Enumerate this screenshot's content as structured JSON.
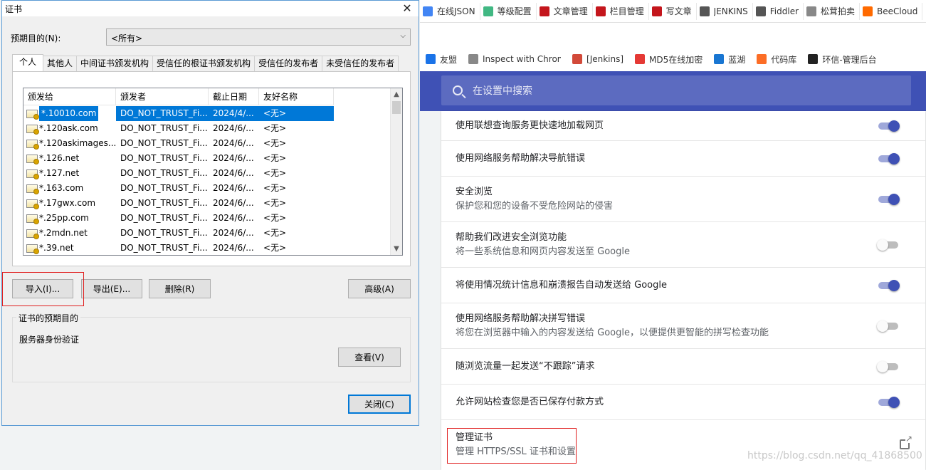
{
  "browser": {
    "bookmarks_row1": [
      {
        "icon": "tab-icon",
        "label": "在线JSON",
        "color": "#4285f4"
      },
      {
        "icon": "vue-icon",
        "label": "等级配置",
        "color": "#41b883"
      },
      {
        "icon": "csdn-icon",
        "label": "文章管理",
        "color": "#c4161c"
      },
      {
        "icon": "csdn-icon",
        "label": "栏目管理",
        "color": "#c4161c"
      },
      {
        "icon": "csdn-icon",
        "label": "写文章",
        "color": "#c4161c"
      },
      {
        "icon": "jenkins-icon",
        "label": "JENKINS",
        "color": "#555555"
      },
      {
        "icon": "fiddler-icon",
        "label": "Fiddler",
        "color": "#555555"
      },
      {
        "icon": "page-icon",
        "label": "松茸拍卖",
        "color": "#888888"
      },
      {
        "icon": "beecloud-icon",
        "label": "BeeCloud",
        "color": "#ff6a00"
      }
    ],
    "bookmarks_row2": [
      {
        "icon": "youmeng-icon",
        "label": "友盟",
        "color": "#1a73e8"
      },
      {
        "icon": "page-icon",
        "label": "Inspect with Chrome",
        "color": "#888888"
      },
      {
        "icon": "jenkins-icon",
        "label": "[Jenkins]",
        "color": "#d24939"
      },
      {
        "icon": "md5-icon",
        "label": "MD5在线加密",
        "color": "#e53935"
      },
      {
        "icon": "lanhu-icon",
        "label": "蓝湖",
        "color": "#1976d2"
      },
      {
        "icon": "gitlab-icon",
        "label": "代码库",
        "color": "#fc6d26"
      },
      {
        "icon": "huanxin-icon",
        "label": "环信-管理后台",
        "color": "#222222"
      }
    ],
    "search_placeholder": "在设置中搜索",
    "settings_rows": [
      {
        "title": "使用联想查询服务更快速地加载网页",
        "desc": "",
        "toggle": true
      },
      {
        "title": "使用网络服务帮助解决导航错误",
        "desc": "",
        "toggle": true
      },
      {
        "title": "安全浏览",
        "desc": "保护您和您的设备不受危险网站的侵害",
        "toggle": true
      },
      {
        "title": "帮助我们改进安全浏览功能",
        "desc": "将一些系统信息和网页内容发送至 Google",
        "toggle": false
      },
      {
        "title": "将使用情况统计信息和崩溃报告自动发送给 Google",
        "desc": "",
        "toggle": true
      },
      {
        "title": "使用网络服务帮助解决拼写错误",
        "desc": "将您在浏览器中输入的内容发送给 Google，以便提供更智能的拼写检查功能",
        "toggle": false
      },
      {
        "title": "随浏览流量一起发送“不跟踪”请求",
        "desc": "",
        "toggle": false
      },
      {
        "title": "允许网站检查您是否已保存付款方式",
        "desc": "",
        "toggle": true
      },
      {
        "title": "管理证书",
        "desc": "管理 HTTPS/SSL 证书和设置",
        "toggle": null
      }
    ],
    "watermark": "https://blog.csdn.net/qq_41868500"
  },
  "dialog": {
    "title": "证书",
    "close_glyph": "✕",
    "purpose_label": "预期目的(N):",
    "purpose_value": "<所有>",
    "tabs": [
      "个人",
      "其他人",
      "中间证书颁发机构",
      "受信任的根证书颁发机构",
      "受信任的发布者",
      "未受信任的发布者"
    ],
    "columns": [
      "颁发给",
      "颁发者",
      "截止日期",
      "友好名称"
    ],
    "rows": [
      [
        "*.10010.com",
        "DO_NOT_TRUST_Fi...",
        "2024/4/...",
        "<无>"
      ],
      [
        "*.120ask.com",
        "DO_NOT_TRUST_Fi...",
        "2024/6/...",
        "<无>"
      ],
      [
        "*.120askimages....",
        "DO_NOT_TRUST_Fi...",
        "2024/6/...",
        "<无>"
      ],
      [
        "*.126.net",
        "DO_NOT_TRUST_Fi...",
        "2024/6/...",
        "<无>"
      ],
      [
        "*.127.net",
        "DO_NOT_TRUST_Fi...",
        "2024/6/...",
        "<无>"
      ],
      [
        "*.163.com",
        "DO_NOT_TRUST_Fi...",
        "2024/6/...",
        "<无>"
      ],
      [
        "*.17gwx.com",
        "DO_NOT_TRUST_Fi...",
        "2024/6/...",
        "<无>"
      ],
      [
        "*.25pp.com",
        "DO_NOT_TRUST_Fi...",
        "2024/6/...",
        "<无>"
      ],
      [
        "*.2mdn.net",
        "DO_NOT_TRUST_Fi...",
        "2024/6/...",
        "<无>"
      ],
      [
        "*.39.net",
        "DO_NOT_TRUST_Fi...",
        "2024/6/...",
        "<无>"
      ]
    ],
    "buttons": {
      "import": "导入(I)...",
      "export": "导出(E)...",
      "remove": "删除(R)",
      "advanced": "高级(A)",
      "view": "查看(V)",
      "close": "关闭(C)"
    },
    "purposes_group_title": "证书的预期目的",
    "purposes_value": "服务器身份验证"
  }
}
